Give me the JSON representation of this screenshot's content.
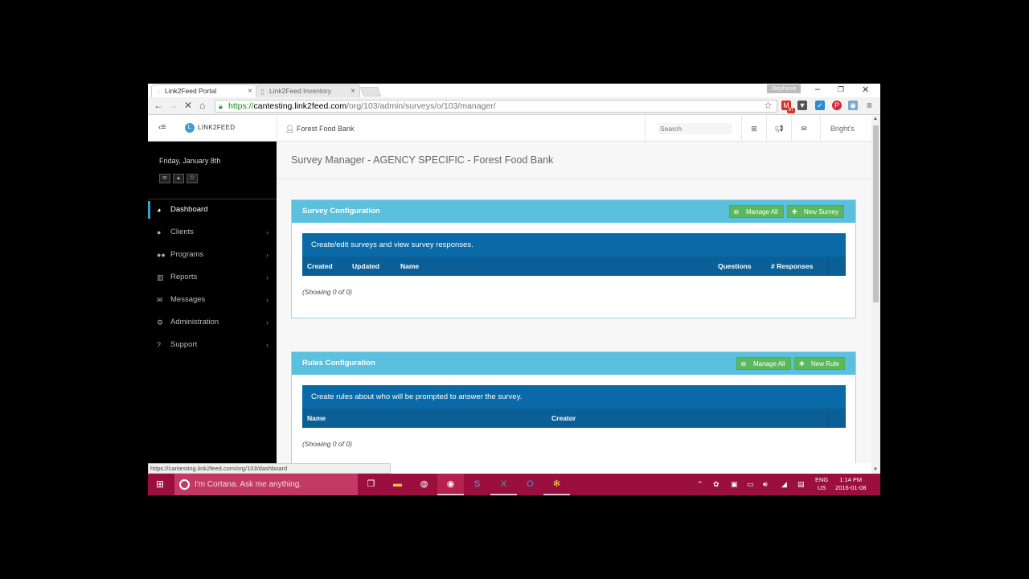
{
  "browser": {
    "tabs": [
      {
        "label": "Link2Feed Portal",
        "active": true
      },
      {
        "label": "Link2Feed Inventory",
        "active": false
      }
    ],
    "profile_name": "Stephanie",
    "url": {
      "scheme": "https://",
      "host": "cantesting.link2feed.com",
      "path": "/org/103/admin/surveys/o/103/manager/"
    },
    "status_url": "https://cantesting.link2feed.com/org/103/dashboard",
    "gmail_badge": "87"
  },
  "header": {
    "logo_text": "LINK2FEED",
    "agency": "Forest Food Bank",
    "search_placeholder": "Search",
    "user": "Bright's"
  },
  "sidebar": {
    "date": "Friday, January 8th",
    "items": [
      {
        "label": "Dashboard",
        "icon": "dashboard-icon",
        "active": true
      },
      {
        "label": "Clients",
        "icon": "user-icon"
      },
      {
        "label": "Programs",
        "icon": "users-icon"
      },
      {
        "label": "Reports",
        "icon": "bar-chart-icon"
      },
      {
        "label": "Messages",
        "icon": "envelope-icon"
      },
      {
        "label": "Administration",
        "icon": "cogs-icon"
      },
      {
        "label": "Support",
        "icon": "question-icon"
      }
    ]
  },
  "main": {
    "page_title": "Survey Manager - AGENCY SPECIFIC - Forest Food Bank",
    "survey_panel": {
      "title": "Survey Configuration",
      "manage_all": "Manage All",
      "new_button": "New Survey",
      "info": "Create/edit surveys and view survey responses.",
      "columns": [
        "Created",
        "Updated",
        "Name",
        "Questions",
        "# Responses"
      ],
      "showing": "(Showing 0 of 0)"
    },
    "rules_panel": {
      "title": "Rules Configuration",
      "manage_all": "Manage All",
      "new_button": "New Rule",
      "info": "Create rules about who will be prompted to answer the survey.",
      "columns": [
        "Name",
        "Creator"
      ],
      "showing": "(Showing 0 of 0)"
    }
  },
  "taskbar": {
    "cortana_text": "I'm Cortana. Ask me anything.",
    "lang_line1": "ENG",
    "lang_line2": "US",
    "time": "1:14 PM",
    "date": "2016-01-08"
  },
  "colors": {
    "panel_header": "#5bc0de",
    "info_bar": "#0a6aa8",
    "button_green": "#5cb85c",
    "taskbar": "#9a0f3e",
    "sidebar": "#000000"
  }
}
